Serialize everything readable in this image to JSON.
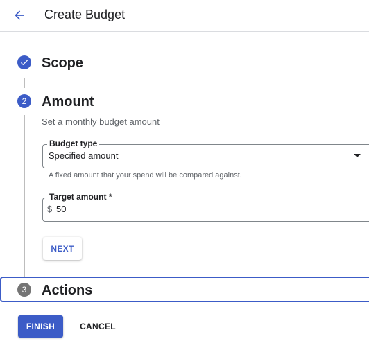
{
  "header": {
    "title": "Create Budget",
    "back_icon": "arrow-back-icon"
  },
  "colors": {
    "accent": "#3c5cc7",
    "step_inactive": "#757575",
    "connector": "#bdbdbd"
  },
  "steps": [
    {
      "number": "1",
      "title": "Scope",
      "state": "completed",
      "icon": "check-icon"
    },
    {
      "number": "2",
      "title": "Amount",
      "state": "active"
    },
    {
      "number": "3",
      "title": "Actions",
      "state": "inactive"
    }
  ],
  "amount": {
    "subtitle": "Set a monthly budget amount",
    "budget_type": {
      "label": "Budget type",
      "value": "Specified amount",
      "helper": "A fixed amount that your spend will be compared against."
    },
    "target_amount": {
      "label": "Target amount *",
      "prefix": "$",
      "value": "50"
    },
    "next_label": "NEXT"
  },
  "footer": {
    "finish_label": "FINISH",
    "cancel_label": "CANCEL"
  }
}
